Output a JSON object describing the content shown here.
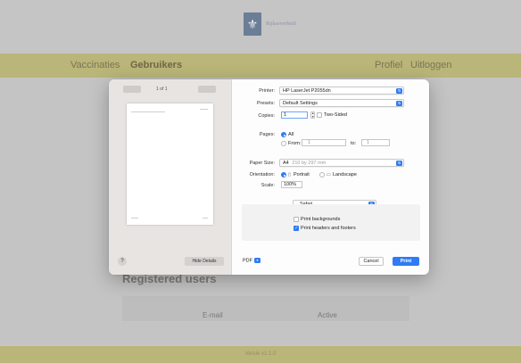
{
  "header": {
    "logo_text": "Rijksoverheid"
  },
  "nav": {
    "vaccinaties": "Vaccinaties",
    "gebruikers": "Gebruikers",
    "profiel": "Profiel",
    "uitloggen": "Uitloggen"
  },
  "main": {
    "title": "Registered users",
    "columns": [
      "E-mail",
      "Active"
    ]
  },
  "footer": {
    "version": "Versie v1.1.0"
  },
  "print_dialog": {
    "preview": {
      "page_count": "1 of 1",
      "help": "?",
      "hide_details": "Hide Details"
    },
    "printer": {
      "label": "Printer:",
      "value": "HP LaserJet P2055dn"
    },
    "presets": {
      "label": "Presets:",
      "value": "Default Settings"
    },
    "copies": {
      "label": "Copies:",
      "value": "1",
      "two_sided": "Two-Sided"
    },
    "pages": {
      "label": "Pages:",
      "all": "All",
      "from": "From:",
      "from_value": "1",
      "to": "to:",
      "to_value": "1"
    },
    "paper_size": {
      "label": "Paper Size:",
      "value": "A4",
      "dims": "210 by 297 mm"
    },
    "orientation": {
      "label": "Orientation:",
      "portrait": "Portrait",
      "landscape": "Landscape"
    },
    "scale": {
      "label": "Scale:",
      "value": "100%"
    },
    "app_menu": {
      "value": "Safari"
    },
    "print_backgrounds": {
      "label": "Print backgrounds",
      "checked": false
    },
    "print_headers_footers": {
      "label": "Print headers and footers",
      "checked": true
    },
    "pdf": "PDF",
    "cancel": "Cancel",
    "print": "Print"
  },
  "colors": {
    "accent": "#2f7bf4",
    "nav_bar": "#bab578"
  }
}
